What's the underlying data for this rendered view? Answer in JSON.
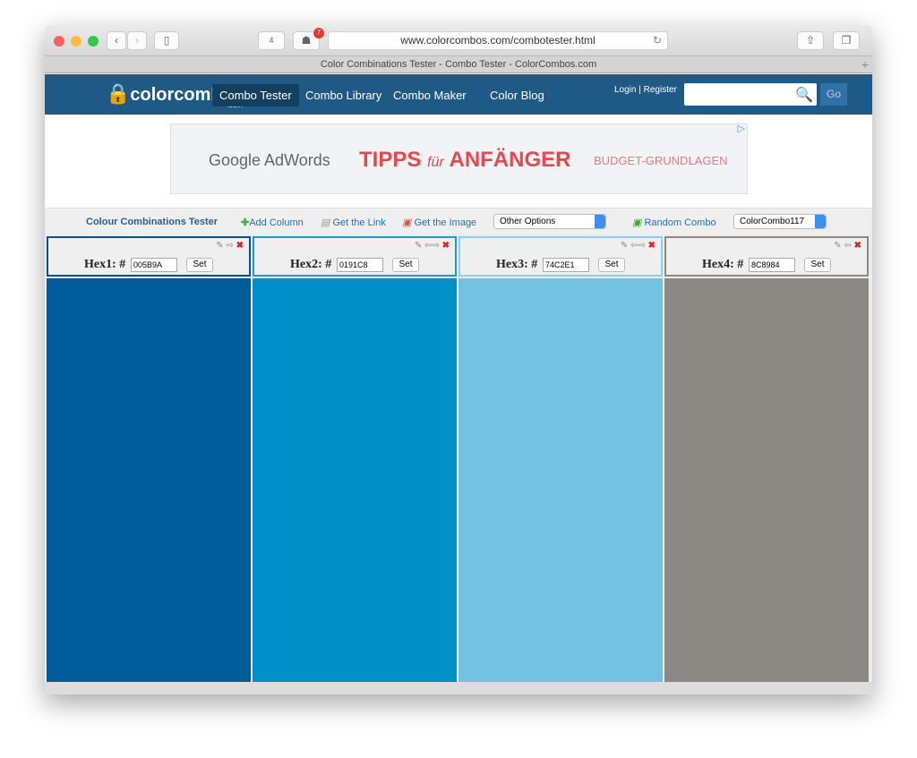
{
  "browser": {
    "url": "www.colorcombos.com/combotester.html",
    "tab_title": "Color Combinations Tester - Combo Tester - ColorCombos.com",
    "tabs_count": "4",
    "badge_count": "7"
  },
  "site": {
    "logo": "colorcombos",
    "logo_sub": ".com",
    "nav": [
      "Combo Tester",
      "Combo Library",
      "Combo Maker",
      "Color Blog"
    ],
    "login": "Login",
    "register": "Register",
    "search_placeholder": "",
    "go": "Go"
  },
  "ad": {
    "brand": "Google AdWords",
    "headline": "TIPPS",
    "headline_small": "für",
    "headline2": "ANFÄNGER",
    "tagline": "BUDGET-GRUNDLAGEN"
  },
  "tools": {
    "title": "Colour Combinations Tester",
    "add_column": "Add Column",
    "get_link": "Get the Link",
    "get_image": "Get the Image",
    "other_options": "Other Options",
    "random_combo": "Random Combo",
    "combo_select": "ColorCombo117"
  },
  "columns": [
    {
      "label": "Hex1: #",
      "value": "005B9A",
      "color": "#005B9A",
      "set": "Set"
    },
    {
      "label": "Hex2: #",
      "value": "0191C8",
      "color": "#0191C8",
      "set": "Set"
    },
    {
      "label": "Hex3: #",
      "value": "74C2E1",
      "color": "#74C2E1",
      "set": "Set"
    },
    {
      "label": "Hex4: #",
      "value": "8C8984",
      "color": "#8C8984",
      "set": "Set"
    }
  ]
}
